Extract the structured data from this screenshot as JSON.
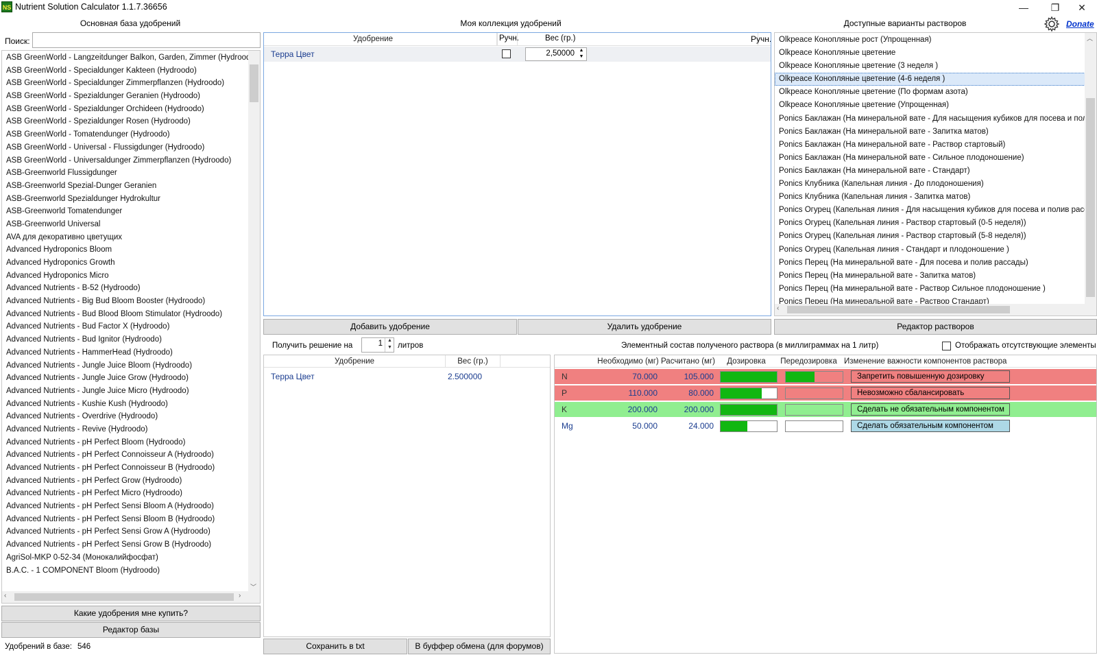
{
  "window": {
    "icon_text": "NS",
    "title": "Nutrient Solution Calculator 1.1.7.36656",
    "donate": "Donate"
  },
  "left": {
    "title": "Основная база удобрений",
    "search_label": "Поиск:",
    "search_value": "",
    "items": [
      "ASB GreenWorld - Langzeitdunger Balkon, Garden, Zimmer (Hydroodo)",
      "ASB GreenWorld - Specialdunger Kakteen (Hydroodo)",
      "ASB GreenWorld - Specialdunger Zimmerpflanzen (Hydroodo)",
      "ASB GreenWorld - Spezialdunger Geranien (Hydroodo)",
      "ASB GreenWorld - Spezialdunger Orchideen (Hydroodo)",
      "ASB GreenWorld - Spezialdunger Rosen (Hydroodo)",
      "ASB GreenWorld - Tomatendunger (Hydroodo)",
      "ASB GreenWorld - Universal - Flussigdunger (Hydroodo)",
      "ASB GreenWorld - Universaldunger Zimmerpflanzen (Hydroodo)",
      "ASB-Greenworld Flussigdunger",
      "ASB-Greenworld Spezial-Dunger Geranien",
      "ASB-Greenworld Spezialdunger Hydrokultur",
      "ASB-Greenworld Tomatendunger",
      "ASB-Greenworld Universal",
      "AVA для декоративно цветущих",
      "Advanced Hydroponics Bloom",
      "Advanced Hydroponics Growth",
      "Advanced Hydroponics Micro",
      "Advanced Nutrients - B-52 (Hydroodo)",
      "Advanced Nutrients - Big Bud Bloom Booster (Hydroodo)",
      "Advanced Nutrients - Bud Blood Bloom Stimulator (Hydroodo)",
      "Advanced Nutrients - Bud Factor X (Hydroodo)",
      "Advanced Nutrients - Bud Ignitor (Hydroodo)",
      "Advanced Nutrients - HammerHead (Hydroodo)",
      "Advanced Nutrients - Jungle Juice Bloom (Hydroodo)",
      "Advanced Nutrients - Jungle Juice Grow (Hydroodo)",
      "Advanced Nutrients - Jungle Juice Micro (Hydroodo)",
      "Advanced Nutrients - Kushie Kush (Hydroodo)",
      "Advanced Nutrients - Overdrive (Hydroodo)",
      "Advanced Nutrients - Revive (Hydroodo)",
      "Advanced Nutrients - pH Perfect Bloom (Hydroodo)",
      "Advanced Nutrients - pH Perfect Connoisseur A (Hydroodo)",
      "Advanced Nutrients - pH Perfect Connoisseur B (Hydroodo)",
      "Advanced Nutrients - pH Perfect Grow (Hydroodo)",
      "Advanced Nutrients - pH Perfect Micro (Hydroodo)",
      "Advanced Nutrients - pH Perfect Sensi Bloom A (Hydroodo)",
      "Advanced Nutrients - pH Perfect Sensi Bloom B (Hydroodo)",
      "Advanced Nutrients - pH Perfect Sensi Grow A (Hydroodo)",
      "Advanced Nutrients - pH Perfect Sensi Grow B (Hydroodo)",
      "AgriSol-MKP 0-52-34 (Монокалийфосфат)",
      "B.A.C. - 1 COMPONENT Bloom (Hydroodo)"
    ],
    "btn_what_to_buy": "Какие удобрения мне купить?",
    "btn_db_editor": "Редактор базы",
    "count_label": "Удобрений в базе:",
    "count_value": "546"
  },
  "collection": {
    "title": "Моя коллекция удобрений",
    "col_fert": "Удобрение",
    "col_manual": "Ручн.",
    "col_weight": "Вес (гр.)",
    "rows": [
      {
        "name": "Терра Цвет",
        "weight": "2,50000"
      }
    ],
    "btn_add": "Добавить удобрение",
    "btn_remove": "Удалить удобрение"
  },
  "solutions": {
    "title": "Доступные варианты растворов",
    "items": [
      "Olkpeace Конопляные рост (Упрощенная)",
      "Olkpeace Конопляные цветение",
      "Olkpeace Конопляные цветение (3 неделя )",
      "Olkpeace Конопляные цветение (4-6 неделя )",
      "Olkpeace Конопляные цветение (По формам азота)",
      "Olkpeace Конопляные цветение (Упрощенная)",
      "Ponics Баклажан (На минеральной вате - Для насыщения кубиков для посева и поли",
      "Ponics Баклажан (На минеральной вате - Запитка матов)",
      "Ponics Баклажан (На минеральной вате - Раствор стартовый)",
      "Ponics Баклажан (На минеральной вате - Сильное плодоношение)",
      "Ponics Баклажан (На минеральной вате - Стандарт)",
      "Ponics Клубника (Капельная линия - До плодоношения)",
      "Ponics Клубника (Капельная линия - Запитка матов)",
      "Ponics Огурец (Капельная линия - Для насыщения кубиков для посева и полив расса",
      "Ponics Огурец (Капельная линия - Раствор стартовый (0-5 неделя))",
      "Ponics Огурец (Капельная линия - Раствор стартовый (5-8 неделя))",
      "Ponics Огурец (Капельная линия - Стандарт и плодоношение )",
      "Ponics Перец (На минеральной вате - Для посева и полив рассады)",
      "Ponics Перец (На минеральной вате - Запитка матов)",
      "Ponics Перец (На минеральной вате - Раствор Сильное плодоношение )",
      "Ponics Перец (На минеральной вате - Раствор Стандарт)"
    ],
    "selected_index": 3,
    "btn_editor": "Редактор растворов"
  },
  "solve": {
    "label_prefix": "Получить решение на",
    "liters": "1",
    "label_suffix": "литров",
    "col_fert": "Удобрение",
    "col_weight": "Вес (гр.)",
    "rows": [
      {
        "name": "Терра Цвет",
        "weight": "2.500000"
      }
    ],
    "btn_save_txt": "Сохранить в txt",
    "btn_clipboard": "В буффер обмена (для форумов)"
  },
  "elements": {
    "title": "Элементный состав полученого раствора (в миллиграммах на 1 литр)",
    "show_missing_label": "Отображать отсутствующие элементы",
    "col_required": "Необходимо (мг)",
    "col_calculated": "Расчитано (мг)",
    "col_dosage": "Дозировка",
    "col_overdose": "Передозировка",
    "col_importance": "Изменение важности компонентов раствора",
    "rows": [
      {
        "el": "N",
        "required": "70.000",
        "calculated": "105.000",
        "dosage": 1.0,
        "overdose": 0.5,
        "action": "Запретить повышенную дозировку",
        "row_color": "#f08080",
        "btn_color": "#f08080"
      },
      {
        "el": "P",
        "required": "110.000",
        "calculated": "80.000",
        "dosage": 0.727,
        "overdose": 0.0,
        "action": "Невозможно сбалансировать",
        "row_color": "#f08080",
        "btn_color": "#f08080"
      },
      {
        "el": "K",
        "required": "200.000",
        "calculated": "200.000",
        "dosage": 1.0,
        "overdose": 0.0,
        "action": "Сделать не обязательным компонентом",
        "row_color": "#90ee90",
        "btn_color": "#90ee90"
      },
      {
        "el": "Mg",
        "required": "50.000",
        "calculated": "24.000",
        "dosage": 0.48,
        "overdose": 0.0,
        "action": "Сделать обязательным компонентом",
        "row_color": "#ffffff",
        "btn_color": "#add8e6"
      }
    ]
  }
}
